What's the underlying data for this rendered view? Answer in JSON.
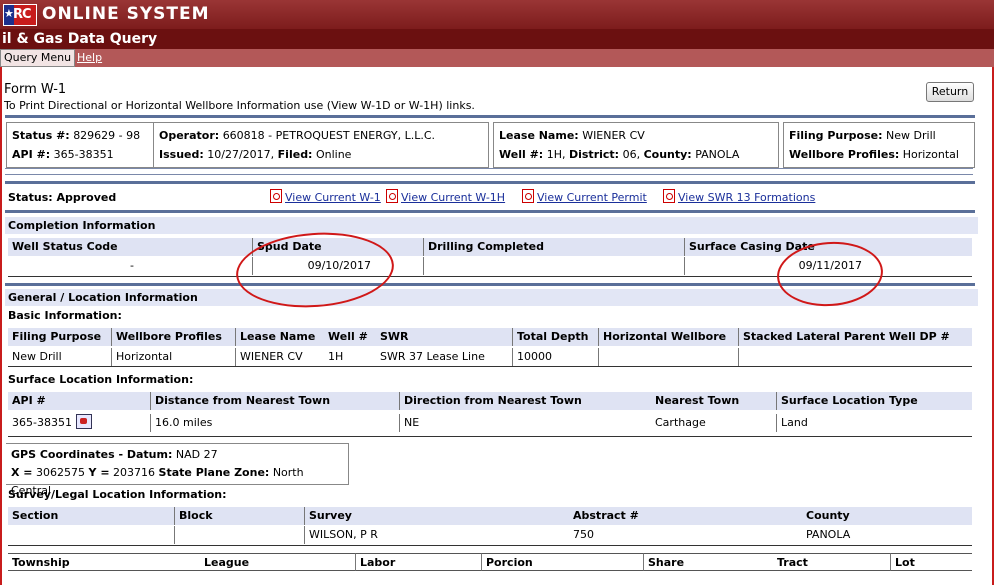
{
  "header": {
    "logo_text": "RC",
    "system_title": "ONLINE SYSTEM",
    "subtitle": "il & Gas Data Query"
  },
  "menu": {
    "query_menu": "Query Menu",
    "help": "Help"
  },
  "form": {
    "title": "Form W-1",
    "note": "To Print Directional or Horizontal Wellbore Information use (View W-1D or W-1H) links.",
    "return_label": "Return"
  },
  "summary": {
    "status_no_label": "Status #:",
    "status_no": "829629 - 98",
    "api_label": "API #:",
    "api": "365-38351",
    "operator_label": "Operator:",
    "operator": "660818 - PETROQUEST ENERGY, L.L.C.",
    "issued_label": "Issued:",
    "issued": "10/27/2017,",
    "filed_label": "Filed:",
    "filed": "Online",
    "lease_label": "Lease Name:",
    "lease": "WIENER CV",
    "well_label": "Well #:",
    "well": "1H,",
    "district_label": "District:",
    "district": "06,",
    "county_label": "County:",
    "county": "PANOLA",
    "filing_purpose_label": "Filing Purpose:",
    "filing_purpose": "New Drill",
    "wellbore_label": "Wellbore Profiles:",
    "wellbore": "Horizontal"
  },
  "status_bar": {
    "status": "Status: Approved",
    "links": [
      "View Current W-1",
      "View Current W-1H",
      "View Current Permit",
      "View SWR 13 Formations"
    ]
  },
  "completion": {
    "section_title": "Completion Information",
    "headers": [
      "Well Status Code",
      "Spud Date",
      "Drilling Completed",
      "Surface Casing Date"
    ],
    "values": [
      "-",
      "09/10/2017",
      "",
      "09/11/2017"
    ]
  },
  "general": {
    "section_title": "General / Location Information",
    "basic_title": "Basic Information:",
    "basic_headers": [
      "Filing Purpose",
      "Wellbore Profiles",
      "Lease Name",
      "Well #",
      "SWR",
      "Total Depth",
      "Horizontal Wellbore",
      "Stacked Lateral Parent Well DP #"
    ],
    "basic_values": [
      "New Drill",
      "Horizontal",
      "WIENER CV",
      "1H",
      "SWR 37 Lease Line",
      "10000",
      "",
      ""
    ],
    "surface_title": "Surface Location Information:",
    "surface_headers": [
      "API #",
      "Distance from Nearest Town",
      "Direction from Nearest Town",
      "Nearest Town",
      "Surface Location Type"
    ],
    "surface_values": [
      "365-38351",
      "16.0 miles",
      "NE",
      "Carthage",
      "Land"
    ],
    "gps_title": "GPS Coordinates - Datum:",
    "gps_datum": "NAD 27",
    "x_label": "X =",
    "x_value": "3062575",
    "y_label": "Y =",
    "y_value": "203716",
    "zone_label": "State Plane Zone:",
    "zone_value": "North Central",
    "survey_title": "Survey/Legal Location Information:",
    "survey_headers": [
      "Section",
      "Block",
      "Survey",
      "Abstract #",
      "County"
    ],
    "survey_values": [
      "",
      "",
      "WILSON, P R",
      "750",
      "PANOLA"
    ],
    "survey2_headers": [
      "Township",
      "League",
      "Labor",
      "Porcion",
      "Share",
      "Tract",
      "Lot"
    ]
  },
  "colors": {
    "brand_red": "#7d1c1c",
    "header_blue": "#dfe3f3",
    "annotation_red": "#d01818"
  }
}
